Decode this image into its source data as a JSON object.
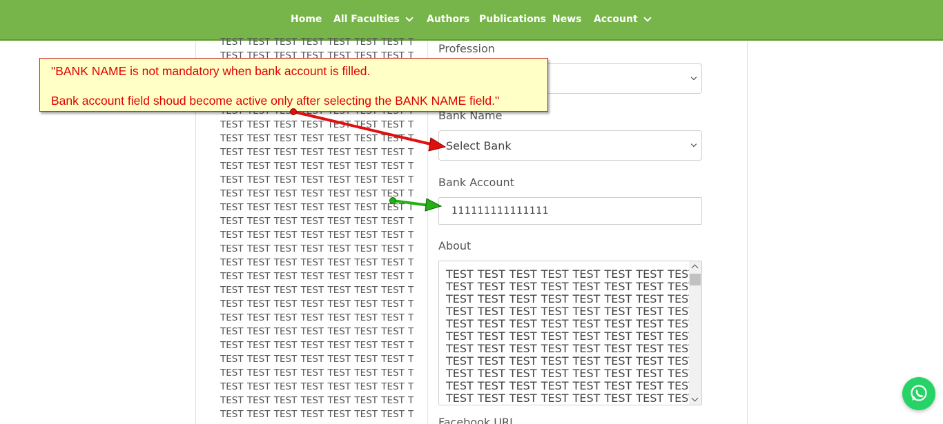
{
  "nav": {
    "items": [
      {
        "label": "Home",
        "dropdown": false
      },
      {
        "label": "All Faculties",
        "dropdown": true
      },
      {
        "label": "Authors",
        "dropdown": false
      },
      {
        "label": "Publications",
        "dropdown": false
      },
      {
        "label": "News",
        "dropdown": false
      },
      {
        "label": "Account",
        "dropdown": true
      }
    ],
    "bg_color": "#77b449"
  },
  "left_column": {
    "lines": [
      "TEST TEST TEST TEST TEST TEST TEST TEST",
      "TEST TEST TEST TEST TEST TEST TEST TEST",
      "TEST TEST TEST TEST TEST TEST TEST TEST",
      "TEST TEST TEST TEST TEST TEST TEST TEST",
      "TEST TEST TEST TEST TEST TEST TEST TEST",
      "TEST TEST TEST TEST TEST TEST TEST TEST",
      "TEST TEST TEST TEST TEST TEST TEST TEST",
      "TEST TEST TEST TEST TEST TEST TEST TEST",
      "TEST TEST TEST TEST TEST TEST TEST TEST",
      "TEST TEST TEST TEST TEST TEST TEST TEST",
      "TEST TEST TEST TEST TEST TEST TEST TEST",
      "TEST TEST TEST TEST TEST TEST TEST TEST",
      "TEST TEST TEST TEST TEST TEST TEST TEST",
      "TEST TEST TEST TEST TEST TEST TEST TEST",
      "TEST TEST TEST TEST TEST TEST TEST TEST",
      "TEST TEST TEST TEST TEST TEST TEST TEST",
      "TEST TEST TEST TEST TEST TEST TEST TEST",
      "TEST TEST TEST TEST TEST TEST TEST TEST",
      "TEST TEST TEST TEST TEST TEST TEST TEST",
      "TEST TEST TEST TEST TEST TEST TEST TEST",
      "TEST TEST TEST TEST TEST TEST TEST TEST",
      "TEST TEST TEST TEST TEST TEST TEST TEST",
      "TEST TEST TEST TEST TEST TEST TEST TEST",
      "TEST TEST TEST TEST TEST TEST TEST TEST",
      "TEST TEST TEST TEST TEST TEST TEST TEST",
      "TEST TEST TEST TEST TEST TEST TEST TEST",
      "TEST TEST TEST TEST TEST TEST TEST TEST",
      "TEST TEST TEST TEST TEST TEST TEST TEST"
    ]
  },
  "form": {
    "profession_label": "Profession",
    "profession_value": "",
    "bank_name_label": "Bank Name",
    "bank_name_value": "Select Bank",
    "bank_account_label": "Bank Account",
    "bank_account_value": "111111111111111",
    "about_label": "About",
    "about_lines": [
      "TEST TEST TEST TEST TEST TEST TEST TEST",
      "TEST TEST TEST TEST TEST TEST TEST TEST",
      "TEST TEST TEST TEST TEST TEST TEST TEST",
      "TEST TEST TEST TEST TEST TEST TEST TEST",
      "TEST TEST TEST TEST TEST TEST TEST TEST",
      "TEST TEST TEST TEST TEST TEST TEST TEST",
      "TEST TEST TEST TEST TEST TEST TEST TEST",
      "TEST TEST TEST TEST TEST TEST TEST TEST",
      "TEST TEST TEST TEST TEST TEST TEST TEST",
      "TEST TEST TEST TEST TEST TEST TEST TEST",
      "TEST TEST TEST TEST TEST TEST TEST TEST"
    ],
    "next_label_partial": "Facebook URL"
  },
  "annotation": {
    "line1": "\"BANK NAME is not mandatory when bank account is filled.",
    "line2": "Bank account field shoud become active only after selecting the BANK NAME field.\"",
    "text_color": "#e00000",
    "bg_color": "#ffffc6",
    "arrow_red_color": "#e01010",
    "arrow_green_color": "#22b014"
  },
  "whatsapp": {
    "icon": "whatsapp-icon",
    "color": "#25d366"
  }
}
